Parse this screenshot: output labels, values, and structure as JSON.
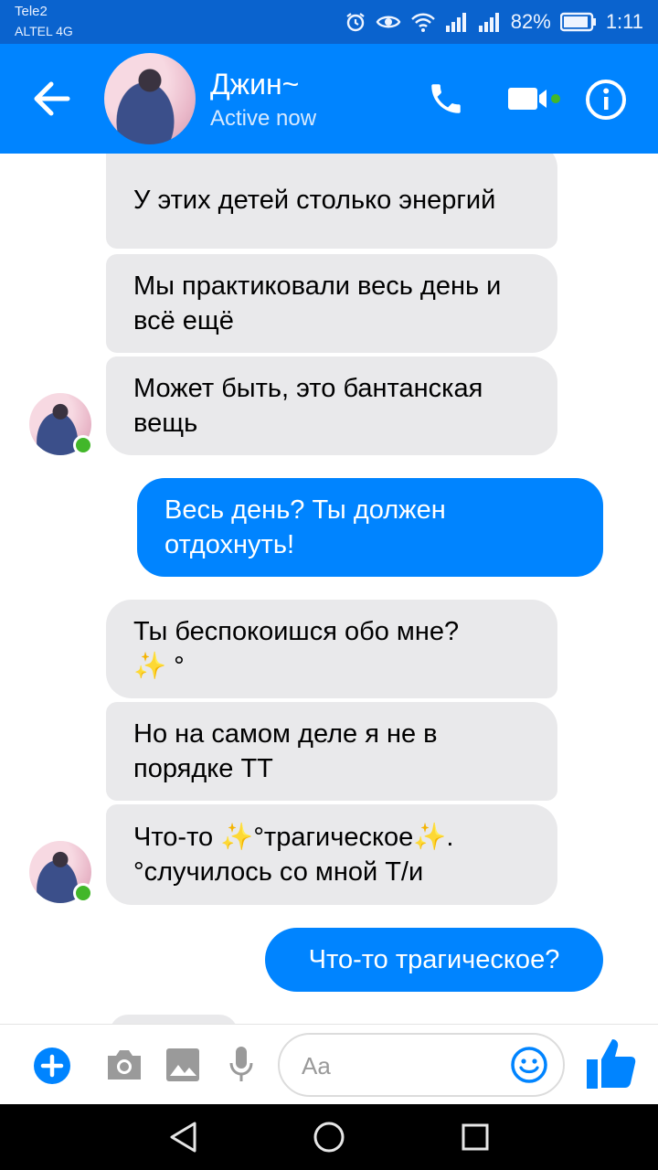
{
  "status_bar": {
    "carrier_1": "Tele2",
    "carrier_2": "ALTEL 4G",
    "battery": "82%",
    "time": "1:11"
  },
  "header": {
    "contact_name": "Джин~",
    "status": "Active now",
    "icons": [
      "back-arrow-icon",
      "phone-icon",
      "video-call-icon",
      "info-icon"
    ]
  },
  "messages": [
    {
      "direction": "in",
      "text": "У этих детей столько энергий"
    },
    {
      "direction": "in",
      "text": "Мы практиковали весь день и всё ещё"
    },
    {
      "direction": "in",
      "text": "Может быть, это бантанская вещь"
    },
    {
      "direction": "out",
      "text": "Весь день? Ты должен отдохнуть!"
    },
    {
      "direction": "in",
      "line1": "Ты беспокоишся обо мне?",
      "line2_emoji": "✨",
      "line2_text": " °"
    },
    {
      "direction": "in",
      "text": "Но на самом деле я не в порядке ТТ"
    },
    {
      "direction": "in",
      "p1": "Что-то ",
      "e1": "✨",
      "p2": "°трагическое",
      "e2": "✨",
      "p3": ".",
      "line2": "°случилось со мной Т/и"
    },
    {
      "direction": "out",
      "text": "Что-то трагическое?"
    }
  ],
  "composer": {
    "placeholder": "Aa",
    "icons": [
      "plus-icon",
      "camera-icon",
      "gallery-icon",
      "microphone-icon",
      "emoji-icon",
      "thumbs-up-icon"
    ]
  },
  "colors": {
    "accent": "#0084ff",
    "status_bar": "#0a63ce",
    "incoming_bubble": "#e9e9eb",
    "online_dot": "#42b72a"
  }
}
